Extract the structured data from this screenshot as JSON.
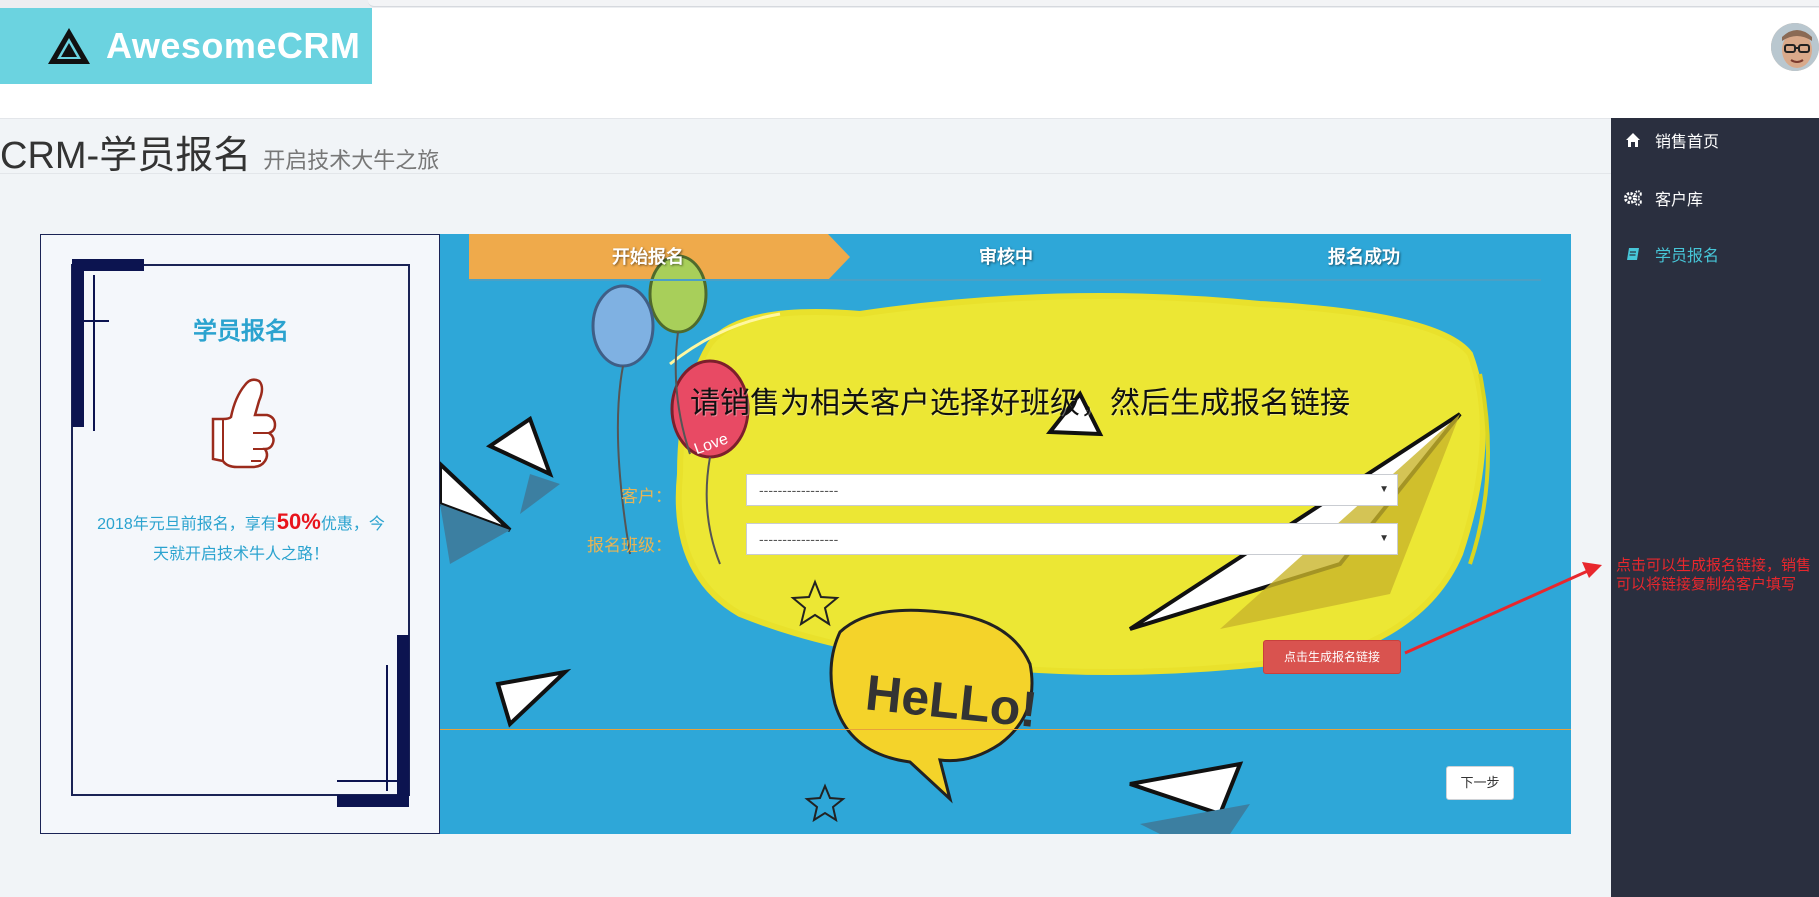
{
  "app": {
    "name": "AwesomeCRM"
  },
  "header": {
    "avatar_alt": "user-avatar"
  },
  "sidebar": {
    "items": [
      {
        "label": "销售首页",
        "icon": "home-icon",
        "active": false
      },
      {
        "label": "客户库",
        "icon": "gears-icon",
        "active": false
      },
      {
        "label": "学员报名",
        "icon": "book-icon",
        "active": true
      }
    ]
  },
  "page": {
    "title": "CRM-学员报名",
    "subtitle": "开启技术大牛之旅"
  },
  "promo": {
    "title": "学员报名",
    "text_prefix": "2018年元旦前报名，享有",
    "highlight": "50%",
    "text_suffix": "优惠，今天就开启技术牛人之路！"
  },
  "wizard": {
    "steps": [
      {
        "label": "开始报名",
        "state": "active"
      },
      {
        "label": "审核中",
        "state": "pending"
      },
      {
        "label": "报名成功",
        "state": "pending"
      }
    ],
    "instruction": "请销售为相关客户选择好班级，然后生成报名链接",
    "fields": [
      {
        "label": "客户：",
        "value": "-----------------"
      },
      {
        "label": "报名班级：",
        "value": "-----------------"
      }
    ],
    "generate_button": "点击生成报名链接",
    "next_button": "下一步"
  },
  "annotation": {
    "text": "点击可以生成报名链接，销售可以将链接复制给客户填写"
  },
  "colors": {
    "logo_bg": "#6bd3e0",
    "sidebar_bg": "#2a2f3f",
    "sidebar_active": "#47c6d8",
    "panel_bg": "#2ea7d8",
    "active_step": "#efaa4b",
    "danger": "#d9534f",
    "accent_blue": "#2ba3cf",
    "annotation_red": "#e8272d"
  }
}
